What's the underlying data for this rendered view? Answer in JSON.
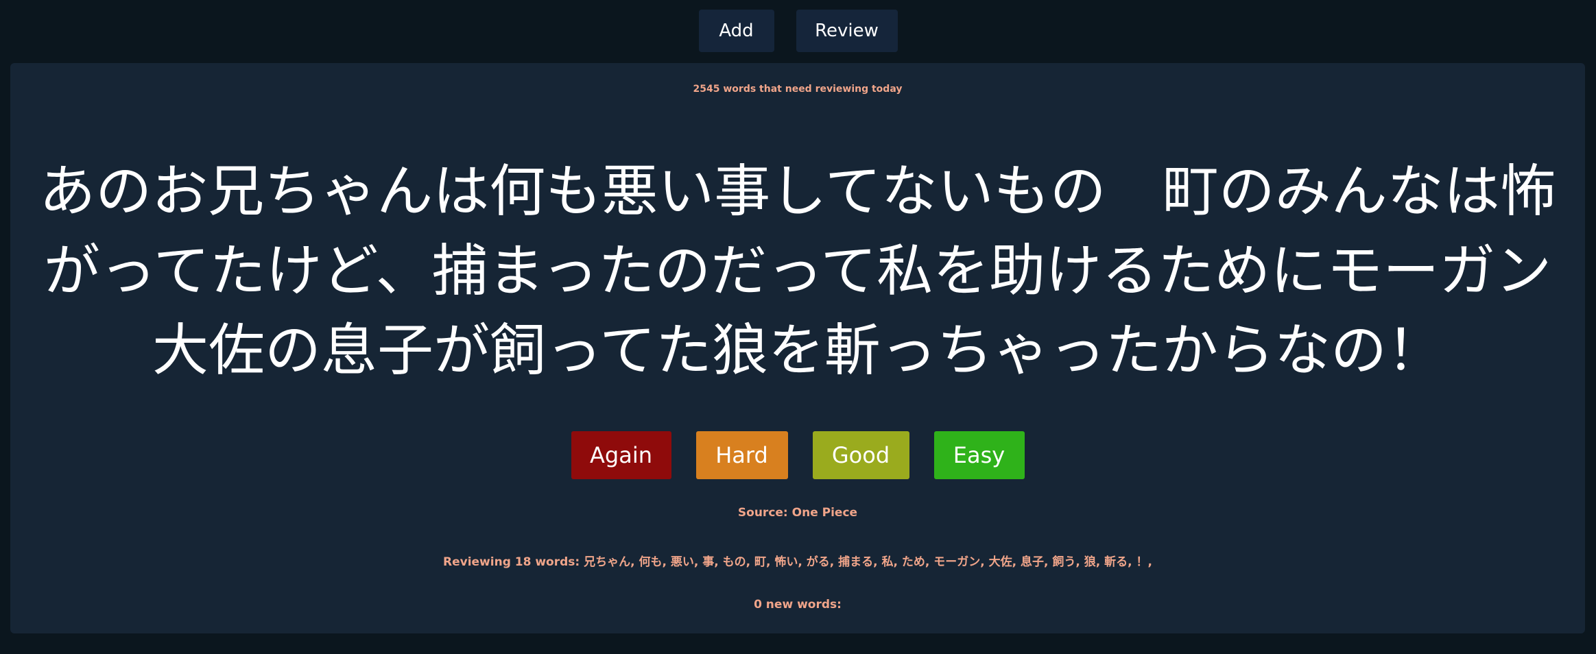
{
  "nav": {
    "add_label": "Add",
    "review_label": "Review"
  },
  "card": {
    "due_text": "2545 words that need reviewing today",
    "sentence": "あのお兄ちゃんは何も悪い事してないもの　町のみんなは怖がってたけど、捕まったのだって私を助けるためにモーガン大佐の息子が飼ってた狼を斬っちゃったからなの！",
    "answers": {
      "again": "Again",
      "hard": "Hard",
      "good": "Good",
      "easy": "Easy"
    },
    "source_text": "Source: One Piece",
    "reviewing_text": "Reviewing 18 words: 兄ちゃん, 何も, 悪い, 事, もの, 町, 怖い, がる, 捕まる, 私, ため, モーガン, 大佐, 息子, 飼う, 狼, 斬る, ！,",
    "new_words_text": "0 new words:"
  },
  "colors": {
    "background": "#0b161e",
    "card": "#162535",
    "nav_button": "#15253a",
    "info_text": "#f0a58a",
    "again": "#8f0b0b",
    "hard": "#d8801f",
    "good": "#9aab1e",
    "easy": "#2fb21a"
  }
}
